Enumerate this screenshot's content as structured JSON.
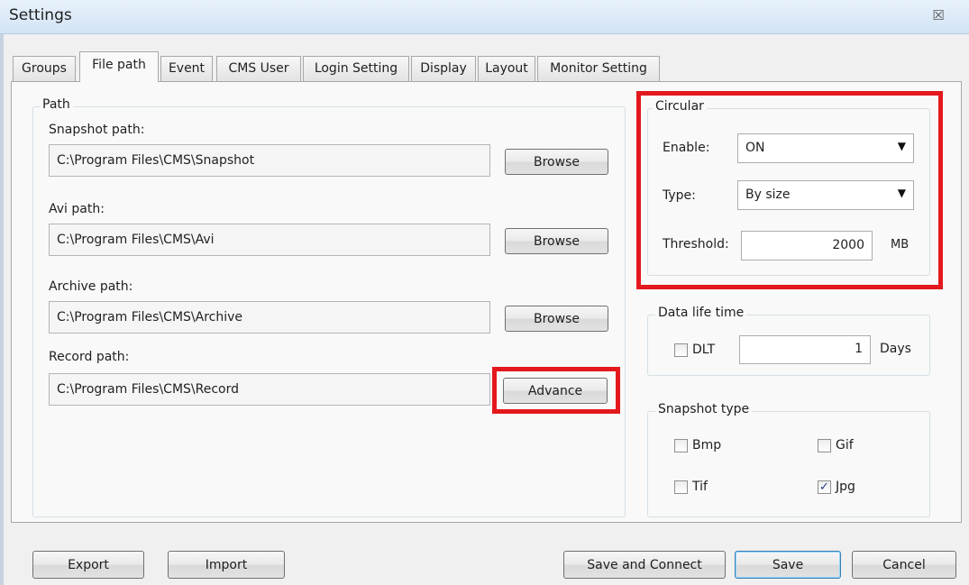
{
  "window": {
    "title": "Settings",
    "close_glyph": "☒"
  },
  "tabs": [
    {
      "label": "Groups",
      "active": false
    },
    {
      "label": "File path",
      "active": true
    },
    {
      "label": "Event",
      "active": false
    },
    {
      "label": "CMS User",
      "active": false
    },
    {
      "label": "Login Setting",
      "active": false
    },
    {
      "label": "Display",
      "active": false
    },
    {
      "label": "Layout",
      "active": false
    },
    {
      "label": "Monitor Setting",
      "active": false
    }
  ],
  "path_group": {
    "legend": "Path",
    "snapshot": {
      "label": "Snapshot path:",
      "value": "C:\\Program Files\\CMS\\Snapshot",
      "button": "Browse"
    },
    "avi": {
      "label": "Avi path:",
      "value": "C:\\Program Files\\CMS\\Avi",
      "button": "Browse"
    },
    "archive": {
      "label": "Archive path:",
      "value": "C:\\Program Files\\CMS\\Archive",
      "button": "Browse"
    },
    "record": {
      "label": "Record path:",
      "value": "C:\\Program Files\\CMS\\Record",
      "button": "Advance"
    }
  },
  "circular": {
    "legend": "Circular",
    "enable_label": "Enable:",
    "enable_value": "ON",
    "type_label": "Type:",
    "type_value": "By size",
    "threshold_label": "Threshold:",
    "threshold_value": "2000",
    "threshold_unit": "MB",
    "dropdown_glyph": "▼"
  },
  "data_life": {
    "legend": "Data life time",
    "dlt_label": "DLT",
    "dlt_checked": false,
    "days_value": "1",
    "days_unit": "Days"
  },
  "snapshot_type": {
    "legend": "Snapshot type",
    "bmp": {
      "label": "Bmp",
      "checked": false
    },
    "gif": {
      "label": "Gif",
      "checked": false
    },
    "tif": {
      "label": "Tif",
      "checked": false
    },
    "jpg": {
      "label": "Jpg",
      "checked": true
    },
    "check_glyph": "✓"
  },
  "footer": {
    "export": "Export",
    "import": "Import",
    "save_connect": "Save and Connect",
    "save": "Save",
    "cancel": "Cancel"
  },
  "colors": {
    "highlight": "#e3191d",
    "title_bar": "#d3e4f5",
    "dialog_bg": "#f0f0f0"
  }
}
